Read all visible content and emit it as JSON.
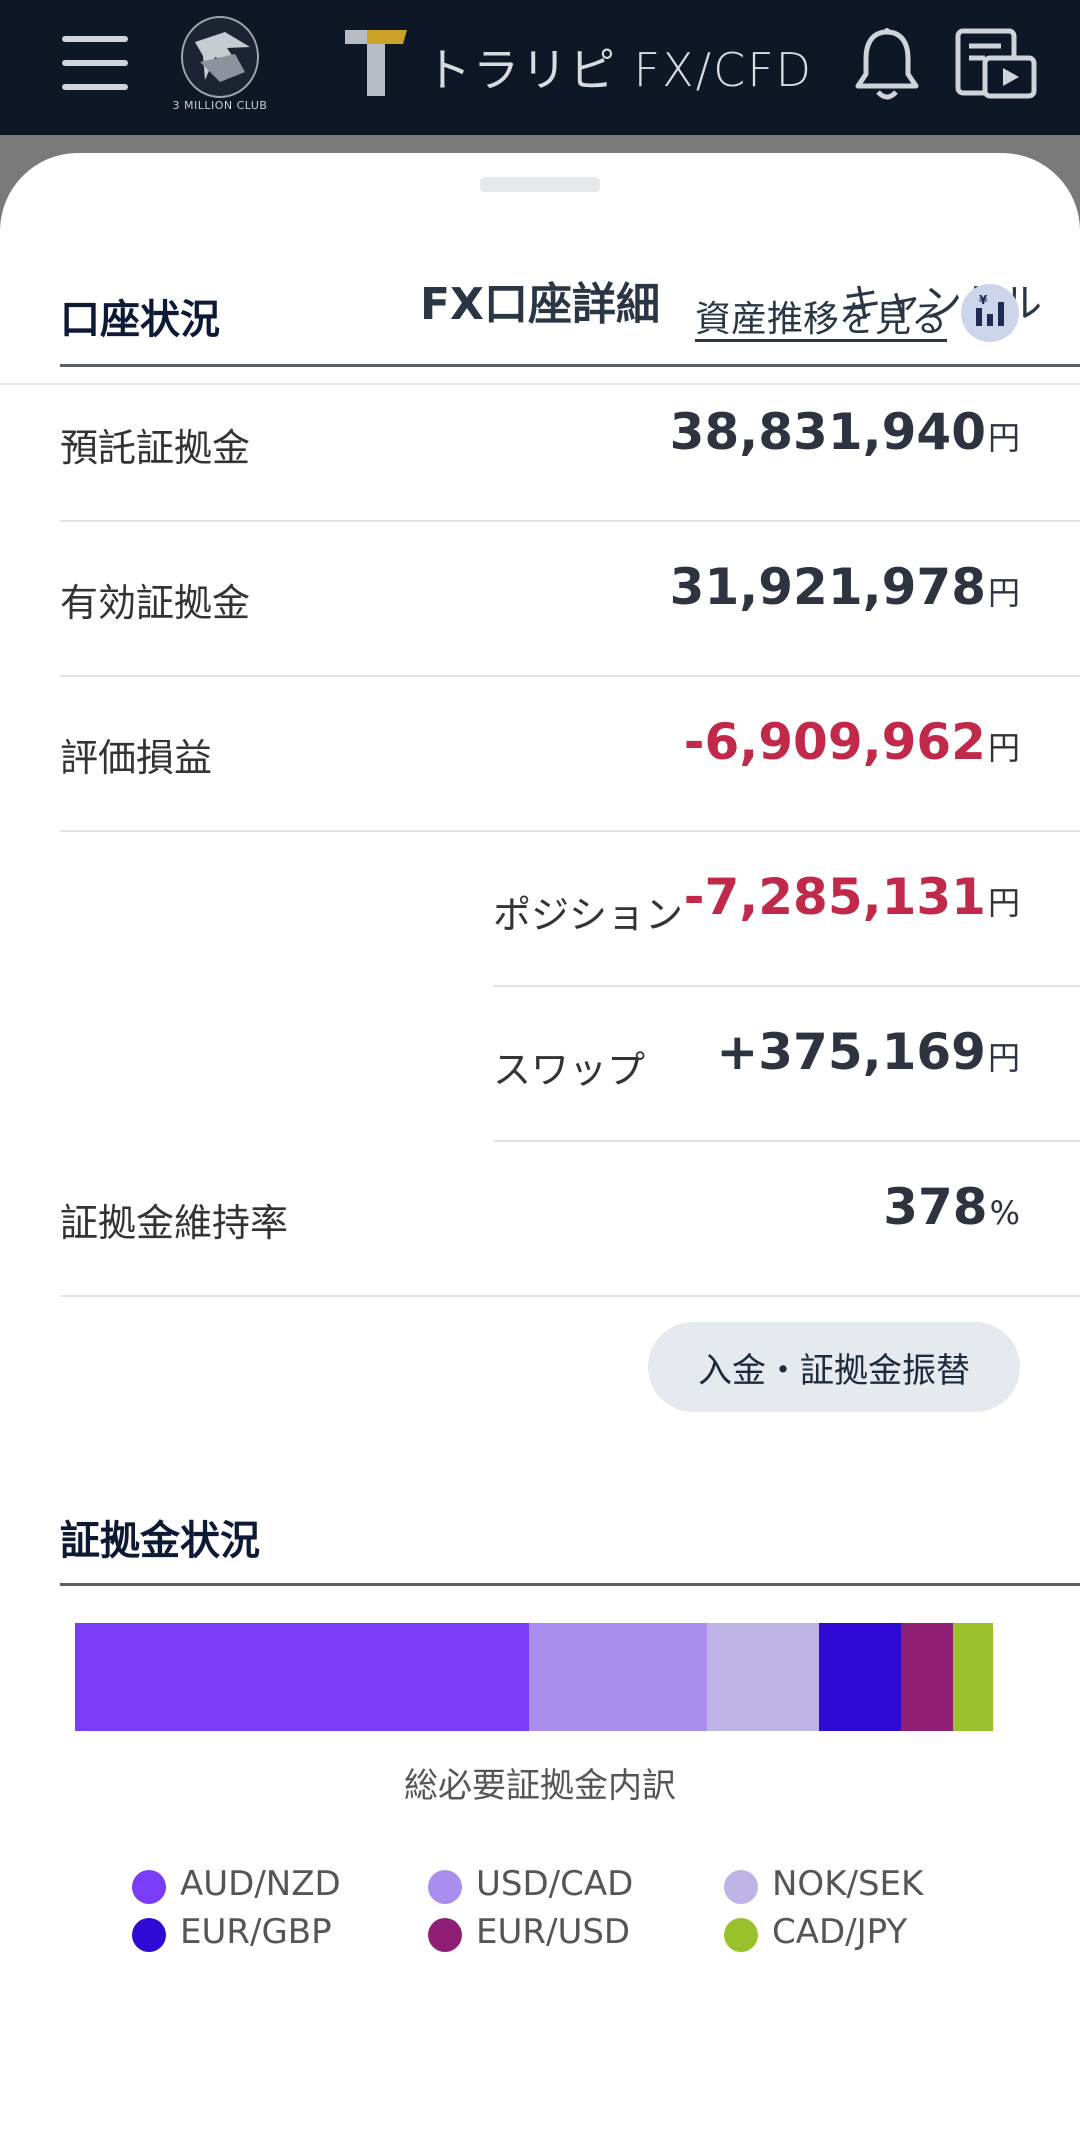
{
  "topbar": {
    "club_caption": "3 MILLION CLUB",
    "brand_text": "トラリピ FX/CFD"
  },
  "sheet": {
    "title": "FX口座詳細",
    "cancel_label": "キャンセル"
  },
  "account_status": {
    "title": "口座状況",
    "trend_link": "資産推移を見る",
    "rows": [
      {
        "label": "預託証拠金",
        "value": "38,831,940",
        "unit": "円"
      },
      {
        "label": "有効証拠金",
        "value": "31,921,978",
        "unit": "円"
      },
      {
        "label": "評価損益",
        "value": "-6,909,962",
        "unit": "円"
      }
    ],
    "sub_rows": [
      {
        "label": "ポジション",
        "value": "-7,285,131",
        "unit": "円"
      },
      {
        "label": "スワップ",
        "value": "+375,169",
        "unit": "円"
      }
    ],
    "maintenance": {
      "label": "証拠金維持率",
      "value": "378",
      "unit": "%"
    },
    "deposit_button": "入金・証拠金振替"
  },
  "margin_status": {
    "title": "証拠金状況",
    "caption": "総必要証拠金内訳",
    "segments": [
      {
        "name": "AUD/NZD",
        "share": 49.5,
        "color": "#7b3cf7"
      },
      {
        "name": "USD/CAD",
        "share": 19.4,
        "color": "#a98ef0"
      },
      {
        "name": "NOK/SEK",
        "share": 12.2,
        "color": "#bfb4e6"
      },
      {
        "name": "EUR/GBP",
        "share": 8.9,
        "color": "#2e0ad4"
      },
      {
        "name": "EUR/USD",
        "share": 5.7,
        "color": "#8f1f74"
      },
      {
        "name": "CAD/JPY",
        "share": 4.3,
        "color": "#98c12b"
      }
    ]
  }
}
